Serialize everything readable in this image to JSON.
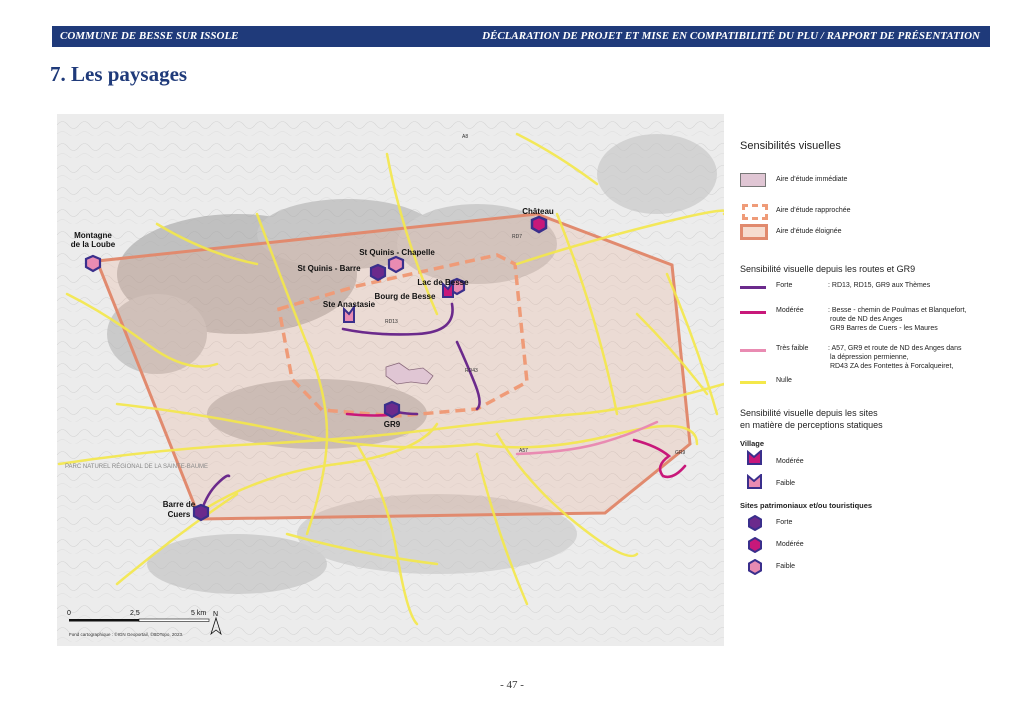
{
  "header": {
    "left": "COMMUNE DE BESSE SUR ISSOLE",
    "right": "DÉCLARATION DE PROJET ET MISE EN COMPATIBILITÉ DU PLU /  RAPPORT DE PRÉSENTATION"
  },
  "section_title": "7. Les paysages",
  "map": {
    "places": {
      "montagne": [
        "Montagne",
        "de la Loube"
      ],
      "chateau": "Château",
      "st_quinis_chapelle": "St Quinis - Chapelle",
      "st_quinis_barre": "St Quinis - Barre",
      "lac_de_besse": "Lac de Besse",
      "bourg_de_besse": "Bourg de Besse",
      "ste_anastasie": "Ste Anastasie",
      "gr9": "GR9",
      "barre_de_cuers": [
        "Barre de",
        "Cuers"
      ]
    },
    "road_labels": {
      "a8": "A8",
      "rd13": "RD13",
      "rd43": "RD43",
      "a57": "A57",
      "rd7": "RD7",
      "gr9": "GR9"
    },
    "background_text": "PARC NATUREL RÉGIONAL DE LA SAINTE-BAUME",
    "scale": {
      "zero": "0",
      "mid": "2,5",
      "end": "5 km"
    },
    "north": "N",
    "credit": "Fond cartographique : ©IGN Geoportail, ©BDTopo, 2023."
  },
  "legend": {
    "title": "Sensibilités visuelles",
    "zone_immediate": "Aire d'étude immédiate",
    "zone_rapprochee": "Aire d'étude rapprochée",
    "zone_eloignee": "Aire d'étude éloignée",
    "routes_title": "Sensibilité visuelle depuis les routes et GR9",
    "routes": [
      {
        "level": "Forte",
        "desc": [
          ": RD13, RD15, GR9 aux Thèmes"
        ],
        "color": "#6b2a8c"
      },
      {
        "level": "Modérée",
        "desc": [
          ": Besse - chemin de Poulmas et Blanquefort,",
          "route de ND des Anges",
          "GR9 Barres de Cuers - les Maures"
        ],
        "color": "#c8187a"
      },
      {
        "level": "Très faible",
        "desc": [
          ": A57, GR9 et route de ND des Anges dans",
          "la dépression permienne,",
          "RD43 ZA des Fontettes à Forcalqueiret,"
        ],
        "color": "#e98bb2"
      },
      {
        "level": "Nulle",
        "desc": [],
        "color": "#f4e84a"
      }
    ],
    "sites_title": [
      "Sensibilité visuelle depuis les sites",
      "en matière de perceptions statiques"
    ],
    "village_title": "Village",
    "village": [
      {
        "level": "Modérée",
        "color": "#c8187a"
      },
      {
        "level": "Faible",
        "color": "#e98bb2"
      }
    ],
    "patrimoine_title": "Sites patrimoniaux et/ou touristiques",
    "patrimoine": [
      {
        "level": "Forte",
        "color": "#6b2a8c"
      },
      {
        "level": "Modérée",
        "color": "#c8187a"
      },
      {
        "level": "Faible",
        "color": "#e98bb2"
      }
    ]
  },
  "page_number": "- 47 -"
}
